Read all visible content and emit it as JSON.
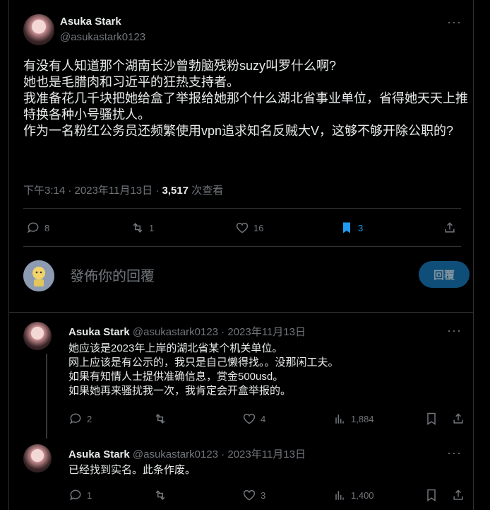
{
  "main": {
    "name": "Asuka Stark",
    "handle": "@asukastark0123",
    "text": "有没有人知道那个湖南长沙曾勃脑残粉suzy叫罗什么啊?\n她也是毛腊肉和习近平的狂热支持者。\n我准备花几千块把她给盒了举报给她那个什么湖北省事业单位，省得她天天上推特换各种小号骚扰人。\n作为一名粉红公务员还频繁使用vpn追求知名反贼大V，这够不够开除公职的?",
    "time": "下午3:14 · 2023年11月13日 · ",
    "views": "3,517",
    "views_label": " 次查看",
    "replies": "8",
    "retweets": "1",
    "likes": "16",
    "bookmarks": "3"
  },
  "reply_box": {
    "placeholder": "發佈你的回覆",
    "button": "回覆"
  },
  "replies": [
    {
      "name": "Asuka Stark",
      "handle_date": "@asukastark0123 · 2023年11月13日",
      "text": "她应该是2023年上岸的湖北省某个机关单位。\n网上应该是有公示的，我只是自己懒得找。。没那闲工夫。\n如果有知情人士提供准确信息，赏金500usd。\n如果她再来骚扰我一次，我肯定会开盒举报的。",
      "replies": "2",
      "retweets": "",
      "likes": "4",
      "views": "1,884"
    },
    {
      "name": "Asuka Stark",
      "handle_date": "@asukastark0123 · 2023年11月13日",
      "text": "已经找到实名。此条作废。",
      "replies": "1",
      "retweets": "",
      "likes": "3",
      "views": "1,400"
    }
  ],
  "more_glyph": "···",
  "accent": "#1d9bf0"
}
